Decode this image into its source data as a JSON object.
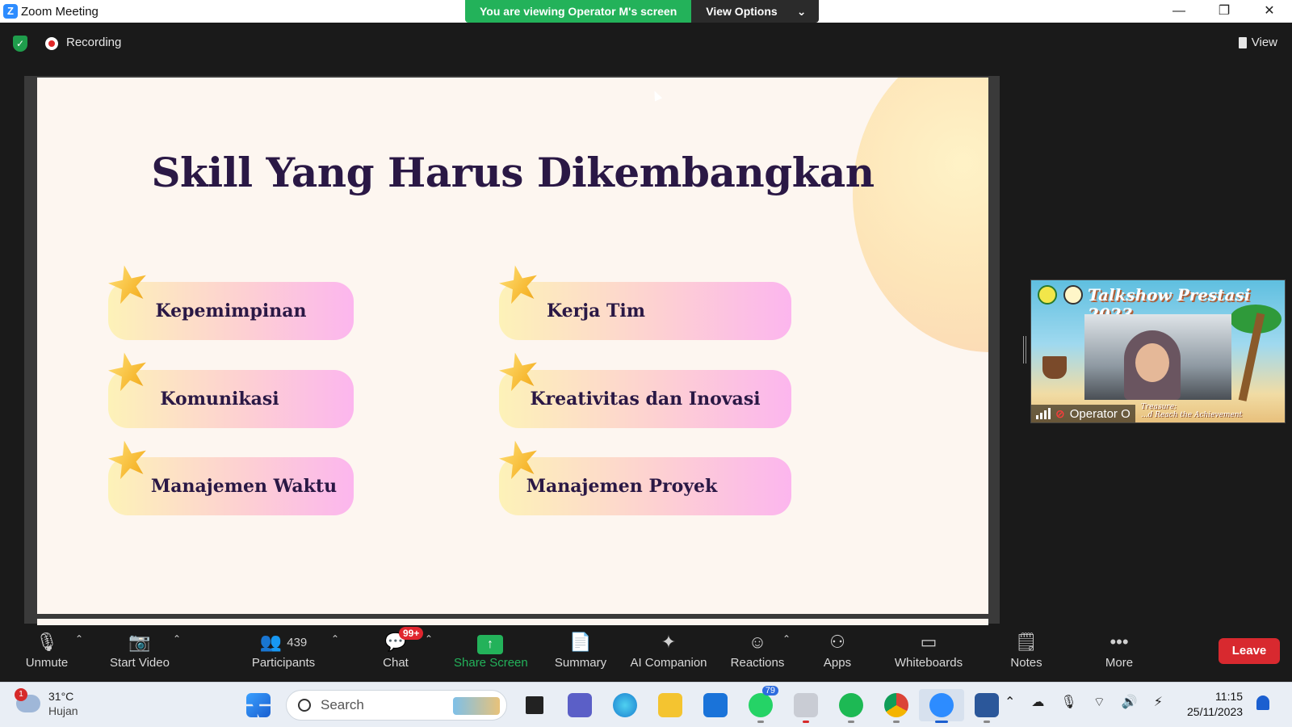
{
  "window": {
    "app_title": "Zoom Meeting",
    "share_banner": "You are viewing Operator M's screen",
    "view_options": "View Options"
  },
  "header": {
    "recording_label": "Recording",
    "view_label": "View"
  },
  "slide": {
    "title": "Skill Yang Harus Dikembangkan",
    "skills_left": [
      "Kepemimpinan",
      "Komunikasi",
      "Manajemen Waktu"
    ],
    "skills_right": [
      "Kerja Tim",
      "Kreativitas dan Inovasi",
      "Manajemen Proyek"
    ]
  },
  "video_tile": {
    "participant_name": "Operator O",
    "banner_text": "Talkshow Prestasi 2023",
    "caption_line1": "Treasure:",
    "caption_line2": "...d Reach the Achievement"
  },
  "toolbar": {
    "unmute": "Unmute",
    "start_video": "Start Video",
    "participants": "Participants",
    "participants_count": "439",
    "chat": "Chat",
    "chat_badge": "99+",
    "share_screen": "Share Screen",
    "summary": "Summary",
    "ai_companion": "AI Companion",
    "reactions": "Reactions",
    "apps": "Apps",
    "whiteboards": "Whiteboards",
    "notes": "Notes",
    "more": "More",
    "leave": "Leave"
  },
  "taskbar": {
    "weather_temp": "31°C",
    "weather_condition": "Hujan",
    "weather_badge": "1",
    "search_placeholder": "Search",
    "whatsapp_badge": "79",
    "time": "11:15",
    "date": "25/11/2023"
  },
  "colors": {
    "share_green": "#23b25a",
    "leave_red": "#d8292f",
    "slide_title": "#2a1845",
    "zoom_blue": "#2d8cff"
  }
}
